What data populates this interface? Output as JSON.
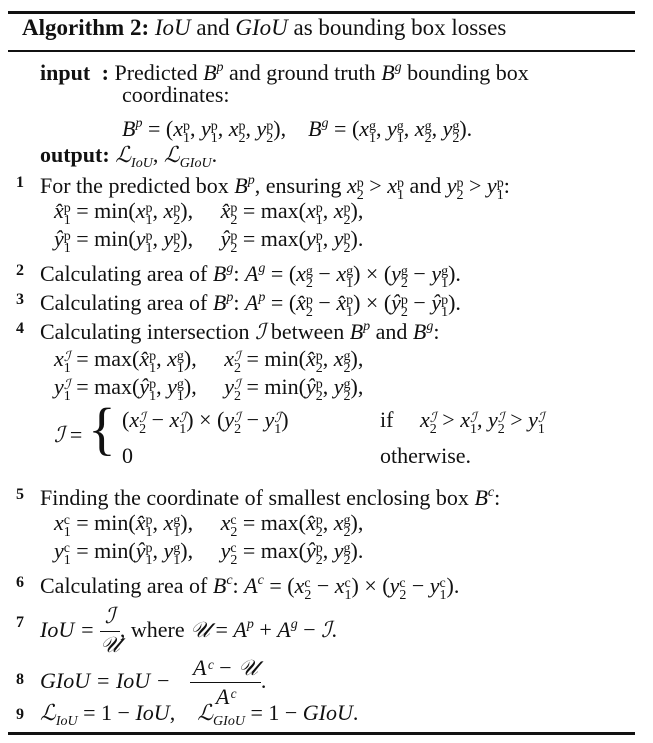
{
  "algorithm": {
    "label": "Algorithm 2:",
    "title_math_1": "IoU",
    "title_text_1": " and ",
    "title_math_2": "GIoU",
    "title_text_2": " as bounding box losses"
  },
  "io": {
    "input_label": "input",
    "input_colon": ":",
    "input_text_1": "Predicted",
    "input_text_2": "and ground truth",
    "input_text_3": "bounding box",
    "input_text_4": "coordinates:",
    "input_formula": "Bᵖ = (x₁ᵖ, y₁ᵖ, x₂ᵖ, y₂ᵖ),   Bᵍ = (x₁ᵍ, y₁ᵍ, x₂ᵍ, y₂ᵍ).",
    "output_label": "output:",
    "output_formula": "ℒ_IoU, ℒ_GIoU."
  },
  "steps": [
    {
      "num": "1",
      "text": "For the predicted box Bᵖ, ensuring x₂ᵖ > x₁ᵖ and y₂ᵖ > y₁ᵖ:",
      "sub": [
        "x̂₁ᵖ = min(x₁ᵖ, x₂ᵖ),    x̂₂ᵖ = max(x₁ᵖ, x₂ᵖ),",
        "ŷ₁ᵖ = min(y₁ᵖ, y₂ᵖ),    ŷ₂ᵖ = max(y₁ᵖ, y₂ᵖ)."
      ]
    },
    {
      "num": "2",
      "text": "Calculating area of Bᵍ: Aᵍ = (x₂ᵍ − x₁ᵍ) × (y₂ᵍ − y₁ᵍ)."
    },
    {
      "num": "3",
      "text": "Calculating area of Bᵖ: Aᵖ = (x̂₂ᵖ − x̂₁ᵖ) × (ŷ₂ᵖ − ŷ₁ᵖ)."
    },
    {
      "num": "4",
      "text": "Calculating intersection ℐ between Bᵖ and Bᵍ:",
      "sub": [
        "x₁ᴵ = max(x̂₁ᵖ, x₁ᵍ),    x₂ᴵ = min(x̂₂ᵖ, x₂ᵍ),",
        "y₁ᴵ = max(ŷ₁ᵖ, y₁ᵍ),    y₂ᴵ = min(ŷ₂ᵖ, y₂ᵍ),"
      ],
      "cases": {
        "lhs": "ℐ =",
        "case1": "(x₂ᴵ − x₁ᴵ) × (y₂ᴵ − y₁ᴵ)",
        "cond1_if": "if",
        "cond1": "x₂ᴵ > x₁ᴵ, y₂ᴵ > y₁ᴵ",
        "case2": "0",
        "cond2": "otherwise."
      }
    },
    {
      "num": "5",
      "text": "Finding the coordinate of smallest enclosing box Bᶜ:",
      "sub": [
        "x₁ᶜ = min(x̂₁ᵖ, x₁ᵍ),    x₂ᶜ = max(x̂₂ᵖ, x₂ᵍ),",
        "y₁ᶜ = min(ŷ₁ᵖ, y₁ᵍ),    y₂ᶜ = max(ŷ₂ᵖ, y₂ᵍ)."
      ]
    },
    {
      "num": "6",
      "text": "Calculating area of Bᶜ: Aᶜ = (x₂ᶜ − x₁ᶜ) × (y₂ᶜ − y₁ᶜ)."
    },
    {
      "num": "7",
      "lhs": "IoU =",
      "frac_num": "ℐ",
      "frac_den": "𝒰",
      "rest": ", where 𝒰 = Aᵖ + Aᵍ − ℐ."
    },
    {
      "num": "8",
      "lhs": "GIoU = IoU −",
      "frac_num": "Aᶜ − 𝒰",
      "frac_den": "Aᶜ",
      "rest": "."
    },
    {
      "num": "9",
      "text": "ℒ_IoU = 1 − IoU,    ℒ_GIoU = 1 − GIoU."
    }
  ]
}
